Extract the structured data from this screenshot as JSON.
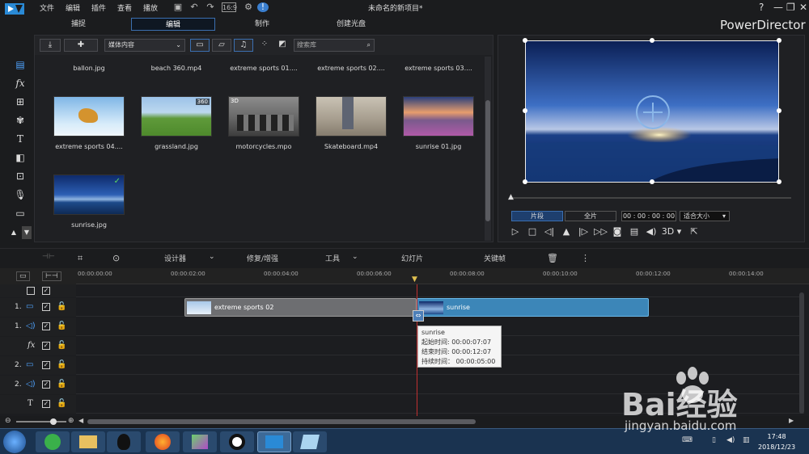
{
  "window": {
    "title": "未命名的新项目*",
    "brand": "PowerDirector"
  },
  "menu": [
    "文件",
    "编辑",
    "插件",
    "查看",
    "播放"
  ],
  "mode_tabs": [
    "捕捉",
    "编辑",
    "制作",
    "创建光盘"
  ],
  "library": {
    "media_select": "媒体内容",
    "search_placeholder": "搜索库",
    "items": [
      {
        "label": "ballon.jpg"
      },
      {
        "label": "beach 360.mp4"
      },
      {
        "label": "extreme sports 01...."
      },
      {
        "label": "extreme sports 02...."
      },
      {
        "label": "extreme sports 03...."
      },
      {
        "label": "extreme sports 04...."
      },
      {
        "label": "grassland.jpg",
        "tag": "360"
      },
      {
        "label": "motorcycles.mpo",
        "tagl": "3D"
      },
      {
        "label": "Skateboard.mp4"
      },
      {
        "label": "sunrise 01.jpg"
      },
      {
        "label": "sunrise.jpg",
        "check": "✓"
      }
    ]
  },
  "preview": {
    "tab_clip": "片段",
    "tab_full": "全片",
    "timecode": "00 : 00 : 00 : 00",
    "fit": "适合大小",
    "mode_3d": "3D"
  },
  "toolbar": {
    "designer": "设计器",
    "fix": "修复/增强",
    "tools": "工具",
    "slideshow": "幻灯片",
    "keyframe": "关键帧"
  },
  "ruler": [
    "00:00:00:00",
    "00:00:02:00",
    "00:00:04:00",
    "00:00:06:00",
    "00:00:08:00",
    "00:00:10:00",
    "00:00:12:00",
    "00:00:14:00"
  ],
  "tracks": [
    {
      "num": "1."
    },
    {
      "num": "1."
    },
    {
      "num": "2."
    },
    {
      "num": "2."
    }
  ],
  "clips": {
    "clip1": "extreme sports 02",
    "clip2": "sunrise"
  },
  "tooltip": {
    "name": "sunrise",
    "start": "起始时间: 00:00:07:07",
    "end": "结束时间: 00:00:12:07",
    "duration": "持续时间：  00:00:05:00"
  },
  "taskbar": {
    "time": "17:48",
    "date": "2018/12/23"
  },
  "watermark": {
    "text": "Bai经验",
    "url": "jingyan.baidu.com"
  }
}
